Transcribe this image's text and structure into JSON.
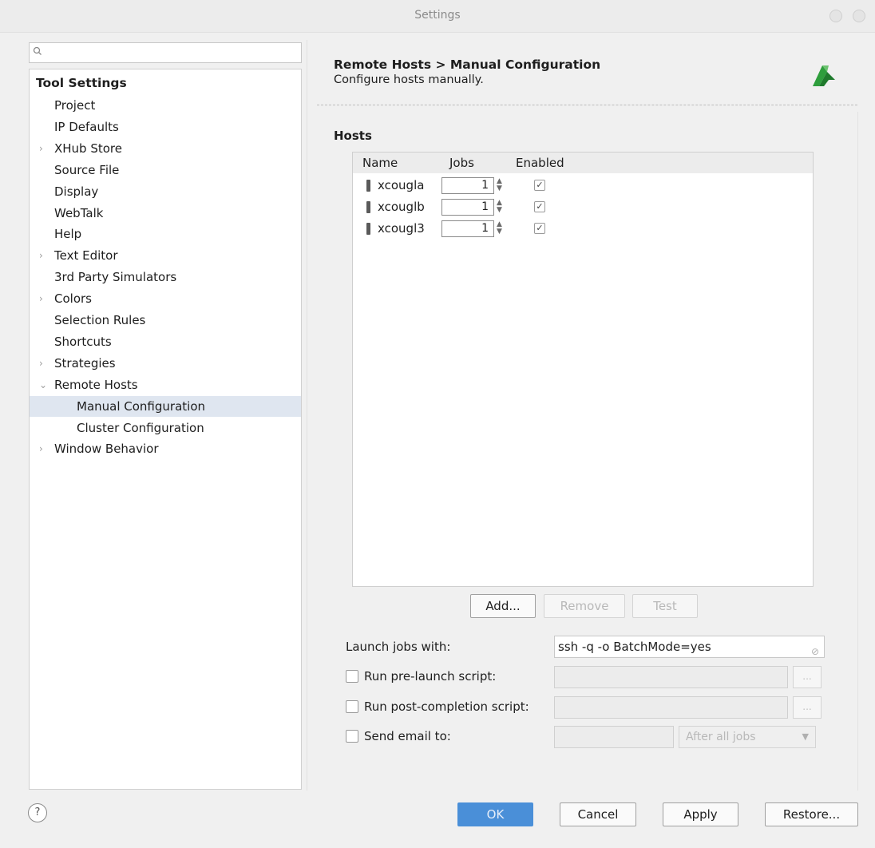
{
  "window": {
    "title": "Settings"
  },
  "search": {
    "placeholder": ""
  },
  "tree": {
    "heading": "Tool Settings",
    "items": [
      {
        "label": "Project",
        "expandable": false,
        "level": 1
      },
      {
        "label": "IP Defaults",
        "expandable": false,
        "level": 1
      },
      {
        "label": "XHub Store",
        "expandable": true,
        "level": 1
      },
      {
        "label": "Source File",
        "expandable": false,
        "level": 1
      },
      {
        "label": "Display",
        "expandable": false,
        "level": 1
      },
      {
        "label": "WebTalk",
        "expandable": false,
        "level": 1
      },
      {
        "label": "Help",
        "expandable": false,
        "level": 1
      },
      {
        "label": "Text Editor",
        "expandable": true,
        "level": 1
      },
      {
        "label": "3rd Party Simulators",
        "expandable": false,
        "level": 1
      },
      {
        "label": "Colors",
        "expandable": true,
        "level": 1
      },
      {
        "label": "Selection Rules",
        "expandable": false,
        "level": 1
      },
      {
        "label": "Shortcuts",
        "expandable": false,
        "level": 1
      },
      {
        "label": "Strategies",
        "expandable": true,
        "level": 1
      },
      {
        "label": "Remote Hosts",
        "expandable": true,
        "expanded": true,
        "level": 1
      },
      {
        "label": "Manual Configuration",
        "expandable": false,
        "level": 2,
        "selected": true
      },
      {
        "label": "Cluster Configuration",
        "expandable": false,
        "level": 2
      },
      {
        "label": "Window Behavior",
        "expandable": true,
        "level": 1
      }
    ]
  },
  "header": {
    "title": "Remote Hosts > Manual Configuration",
    "subtitle": "Configure hosts manually."
  },
  "hosts": {
    "section_label": "Hosts",
    "columns": [
      "Name",
      "Jobs",
      "Enabled"
    ],
    "rows": [
      {
        "name": "xcougla",
        "jobs": "1",
        "enabled": true
      },
      {
        "name": "xcouglb",
        "jobs": "1",
        "enabled": true
      },
      {
        "name": "xcougl3",
        "jobs": "1",
        "enabled": true
      }
    ],
    "buttons": {
      "add": "Add...",
      "remove": "Remove",
      "test": "Test"
    }
  },
  "options": {
    "launch_label": "Launch jobs with:",
    "launch_value": "ssh -q -o BatchMode=yes",
    "pre_launch_label": "Run pre-launch script:",
    "post_completion_label": "Run post-completion script:",
    "email_label": "Send email to:",
    "email_when": "After all jobs",
    "browse_label": "..."
  },
  "footer": {
    "help": "?",
    "ok": "OK",
    "cancel": "Cancel",
    "apply": "Apply",
    "restore": "Restore..."
  },
  "colors": {
    "selection": "#dfe6f0",
    "ok_button": "#4a8fd8",
    "logo": "#2e9e3c"
  },
  "icons": {
    "search": "search-icon",
    "logo": "vivado-logo",
    "help": "help-icon",
    "clear": "clear-icon"
  }
}
